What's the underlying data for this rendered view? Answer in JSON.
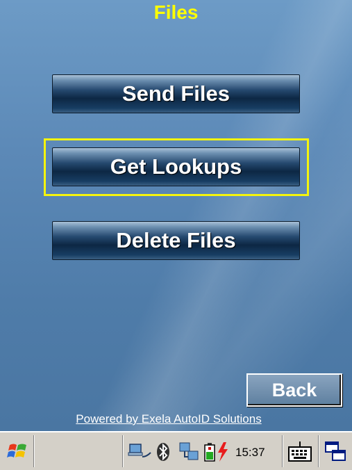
{
  "screen": {
    "title": "Files",
    "buttons": {
      "send_files": "Send Files",
      "get_lookups": "Get Lookups",
      "delete_files": "Delete Files"
    },
    "back_label": "Back",
    "powered_by": "Powered by Exela AutoID Solutions"
  },
  "taskbar": {
    "clock": "15:37",
    "icons": [
      "start-flag-icon",
      "network-icon",
      "bluetooth-icon",
      "connectivity-icon",
      "battery-charging-icon",
      "keyboard-icon",
      "window-switch-icon"
    ]
  },
  "colors": {
    "title": "#ffff00",
    "focus_ring": "#f4f40d",
    "background": "#5b88b6"
  }
}
